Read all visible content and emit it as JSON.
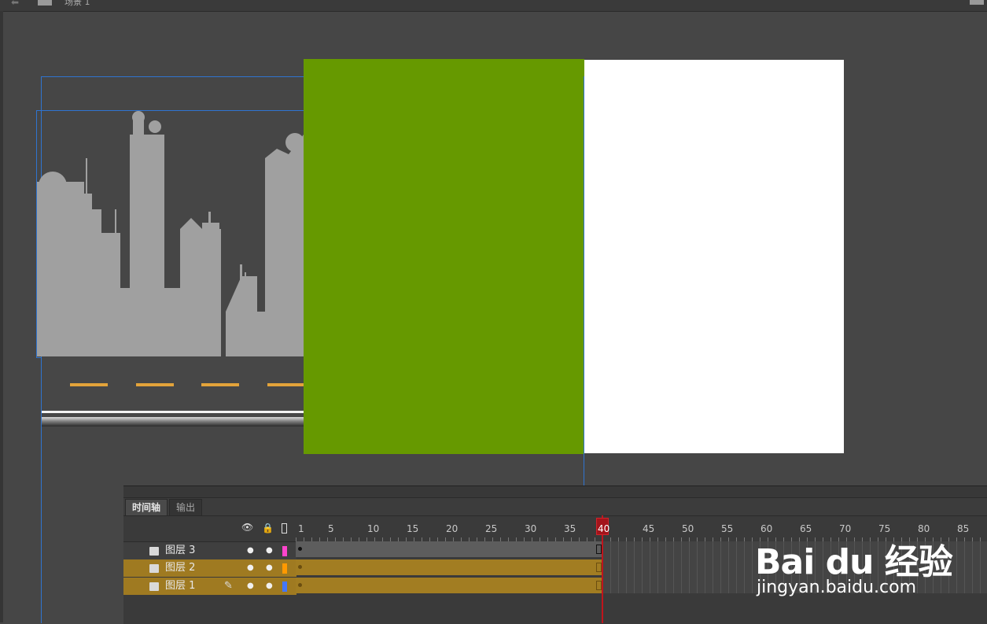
{
  "scene": {
    "name": "场景 1",
    "back_icon": "back-arrow-icon",
    "clapper_icon": "clapper-icon"
  },
  "stage": {
    "green_color": "#669900",
    "white_color": "#ffffff",
    "dash_color": "#e3a33a",
    "selection_color": "#2f74d0",
    "skyline_color": "#a0a0a0"
  },
  "timeline": {
    "tabs": [
      {
        "label": "时间轴"
      },
      {
        "label": "输出"
      }
    ],
    "header_icons": [
      "eye-icon",
      "lock-icon",
      "outline-icon"
    ],
    "frame_numbers": [
      "1",
      "5",
      "10",
      "15",
      "20",
      "25",
      "30",
      "35",
      "40",
      "45",
      "50",
      "55",
      "60",
      "65",
      "70",
      "75",
      "80",
      "85"
    ],
    "current_frame": "40",
    "layers": [
      {
        "name": "图层 3",
        "color": "#ff44cc"
      },
      {
        "name": "图层 2",
        "color": "#ff9900"
      },
      {
        "name": "图层 1",
        "color": "#4477ff",
        "pencil_icon": "pencil-icon"
      }
    ]
  },
  "watermark": {
    "brand": "Bai du 经验",
    "url": "jingyan.baidu.com"
  }
}
